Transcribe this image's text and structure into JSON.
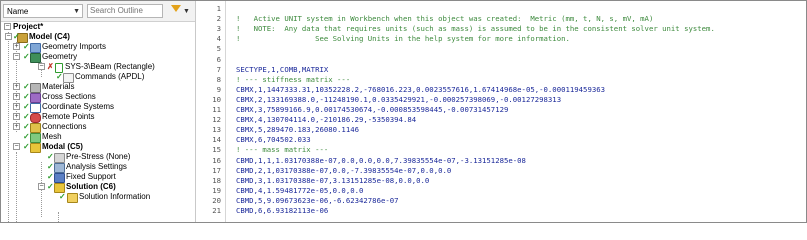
{
  "tree_panel": {
    "name_select": "Name",
    "search_placeholder": "Search Outline",
    "items": [
      {
        "label": "Project*"
      },
      {
        "label": "Model (C4)"
      },
      {
        "label": "Geometry Imports"
      },
      {
        "label": "Geometry"
      },
      {
        "label": "SYS-3\\Beam (Rectangle)"
      },
      {
        "label": "Commands (APDL)"
      },
      {
        "label": "Materials"
      },
      {
        "label": "Cross Sections"
      },
      {
        "label": "Coordinate Systems"
      },
      {
        "label": "Remote Points"
      },
      {
        "label": "Connections"
      },
      {
        "label": "Mesh"
      },
      {
        "label": "Modal (C5)"
      },
      {
        "label": "Pre-Stress (None)"
      },
      {
        "label": "Analysis Settings"
      },
      {
        "label": "Fixed Support"
      },
      {
        "label": "Solution (C6)"
      },
      {
        "label": "Solution Information"
      }
    ]
  },
  "editor": {
    "lines": [
      {
        "n": "1",
        "text": "",
        "kind": "cmd"
      },
      {
        "n": "2",
        "text": "!   Active UNIT system in Workbench when this object was created:  Metric (mm, t, N, s, mV, mA)",
        "kind": "cmt"
      },
      {
        "n": "3",
        "text": "!   NOTE:  Any data that requires units (such as mass) is assumed to be in the consistent solver unit system.",
        "kind": "cmt"
      },
      {
        "n": "4",
        "text": "!                 See Solving Units in the help system for more information.",
        "kind": "cmt"
      },
      {
        "n": "5",
        "text": "",
        "kind": "cmd"
      },
      {
        "n": "6",
        "text": "",
        "kind": "cmd"
      },
      {
        "n": "7",
        "text": "SECTYPE,1,COMB,MATRIX",
        "kind": "cmd"
      },
      {
        "n": "8",
        "text": "! --- stiffness matrix ---",
        "kind": "cmt"
      },
      {
        "n": "9",
        "text": "CBMX,1,1447333.31,10352228.2,-768016.223,0.0023557616,1.67414968e-05,-0.000119459363",
        "kind": "cmd"
      },
      {
        "n": "10",
        "text": "CBMX,2,133169388.0,-11248190.1,0.0335429921,-0.000257398069,-0.00127298313",
        "kind": "cmd"
      },
      {
        "n": "11",
        "text": "CBMX,3,75899166.9,0.00174530674,-0.000853598445,-0.00731457129",
        "kind": "cmd"
      },
      {
        "n": "12",
        "text": "CBMX,4,130704114.0,-210186.29,-5350394.84",
        "kind": "cmd"
      },
      {
        "n": "13",
        "text": "CBMX,5,289470.183,26080.1146",
        "kind": "cmd"
      },
      {
        "n": "14",
        "text": "CBMX,6,704502.033",
        "kind": "cmd"
      },
      {
        "n": "15",
        "text": "! --- mass matrix ---",
        "kind": "cmt"
      },
      {
        "n": "16",
        "text": "CBMD,1,1,1.03170388e-07,0.0,0.0,0.0,7.39835554e-07,-3.13151285e-08",
        "kind": "cmd"
      },
      {
        "n": "17",
        "text": "CBMD,2,1,03170388e-07,0.0,-7.39835554e-07,0.0,0.0",
        "kind": "cmd"
      },
      {
        "n": "18",
        "text": "CBMD,3,1.03170388e-07,3.13151285e-08,0.0,0.0",
        "kind": "cmd"
      },
      {
        "n": "19",
        "text": "CBMD,4,1.59481772e-05,0.0,0.0",
        "kind": "cmd"
      },
      {
        "n": "20",
        "text": "CBMD,5,9.09673623e-06,-6.62342786e-07",
        "kind": "cmd"
      },
      {
        "n": "21",
        "text": "CBMD,6,6.93182113e-06",
        "kind": "cmd"
      }
    ]
  }
}
